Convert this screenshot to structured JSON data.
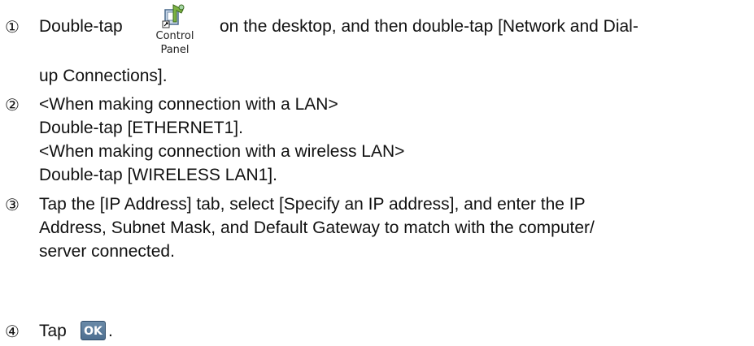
{
  "steps": [
    {
      "marker": "①",
      "line1_before": "Double-tap",
      "icon_name": "control-panel-icon",
      "icon_caption_line1": "Control",
      "icon_caption_line2": "Panel",
      "line1_after": "on the desktop, and then double-tap [Network and Dial-",
      "line2": "up Connections]."
    },
    {
      "marker": "②",
      "lines": [
        "<When making connection with a LAN>",
        "Double-tap [ETHERNET1].",
        "<When making connection with a wireless LAN>",
        "Double-tap [WIRELESS LAN1]."
      ]
    },
    {
      "marker": "③",
      "lines": [
        "Tap the [IP Address] tab, select [Specify an IP address], and enter the IP",
        "Address, Subnet Mask, and Default Gateway to match with the computer/",
        "server connected."
      ]
    },
    {
      "marker": "④",
      "before": "Tap",
      "button_label": "OK",
      "after": "."
    }
  ]
}
